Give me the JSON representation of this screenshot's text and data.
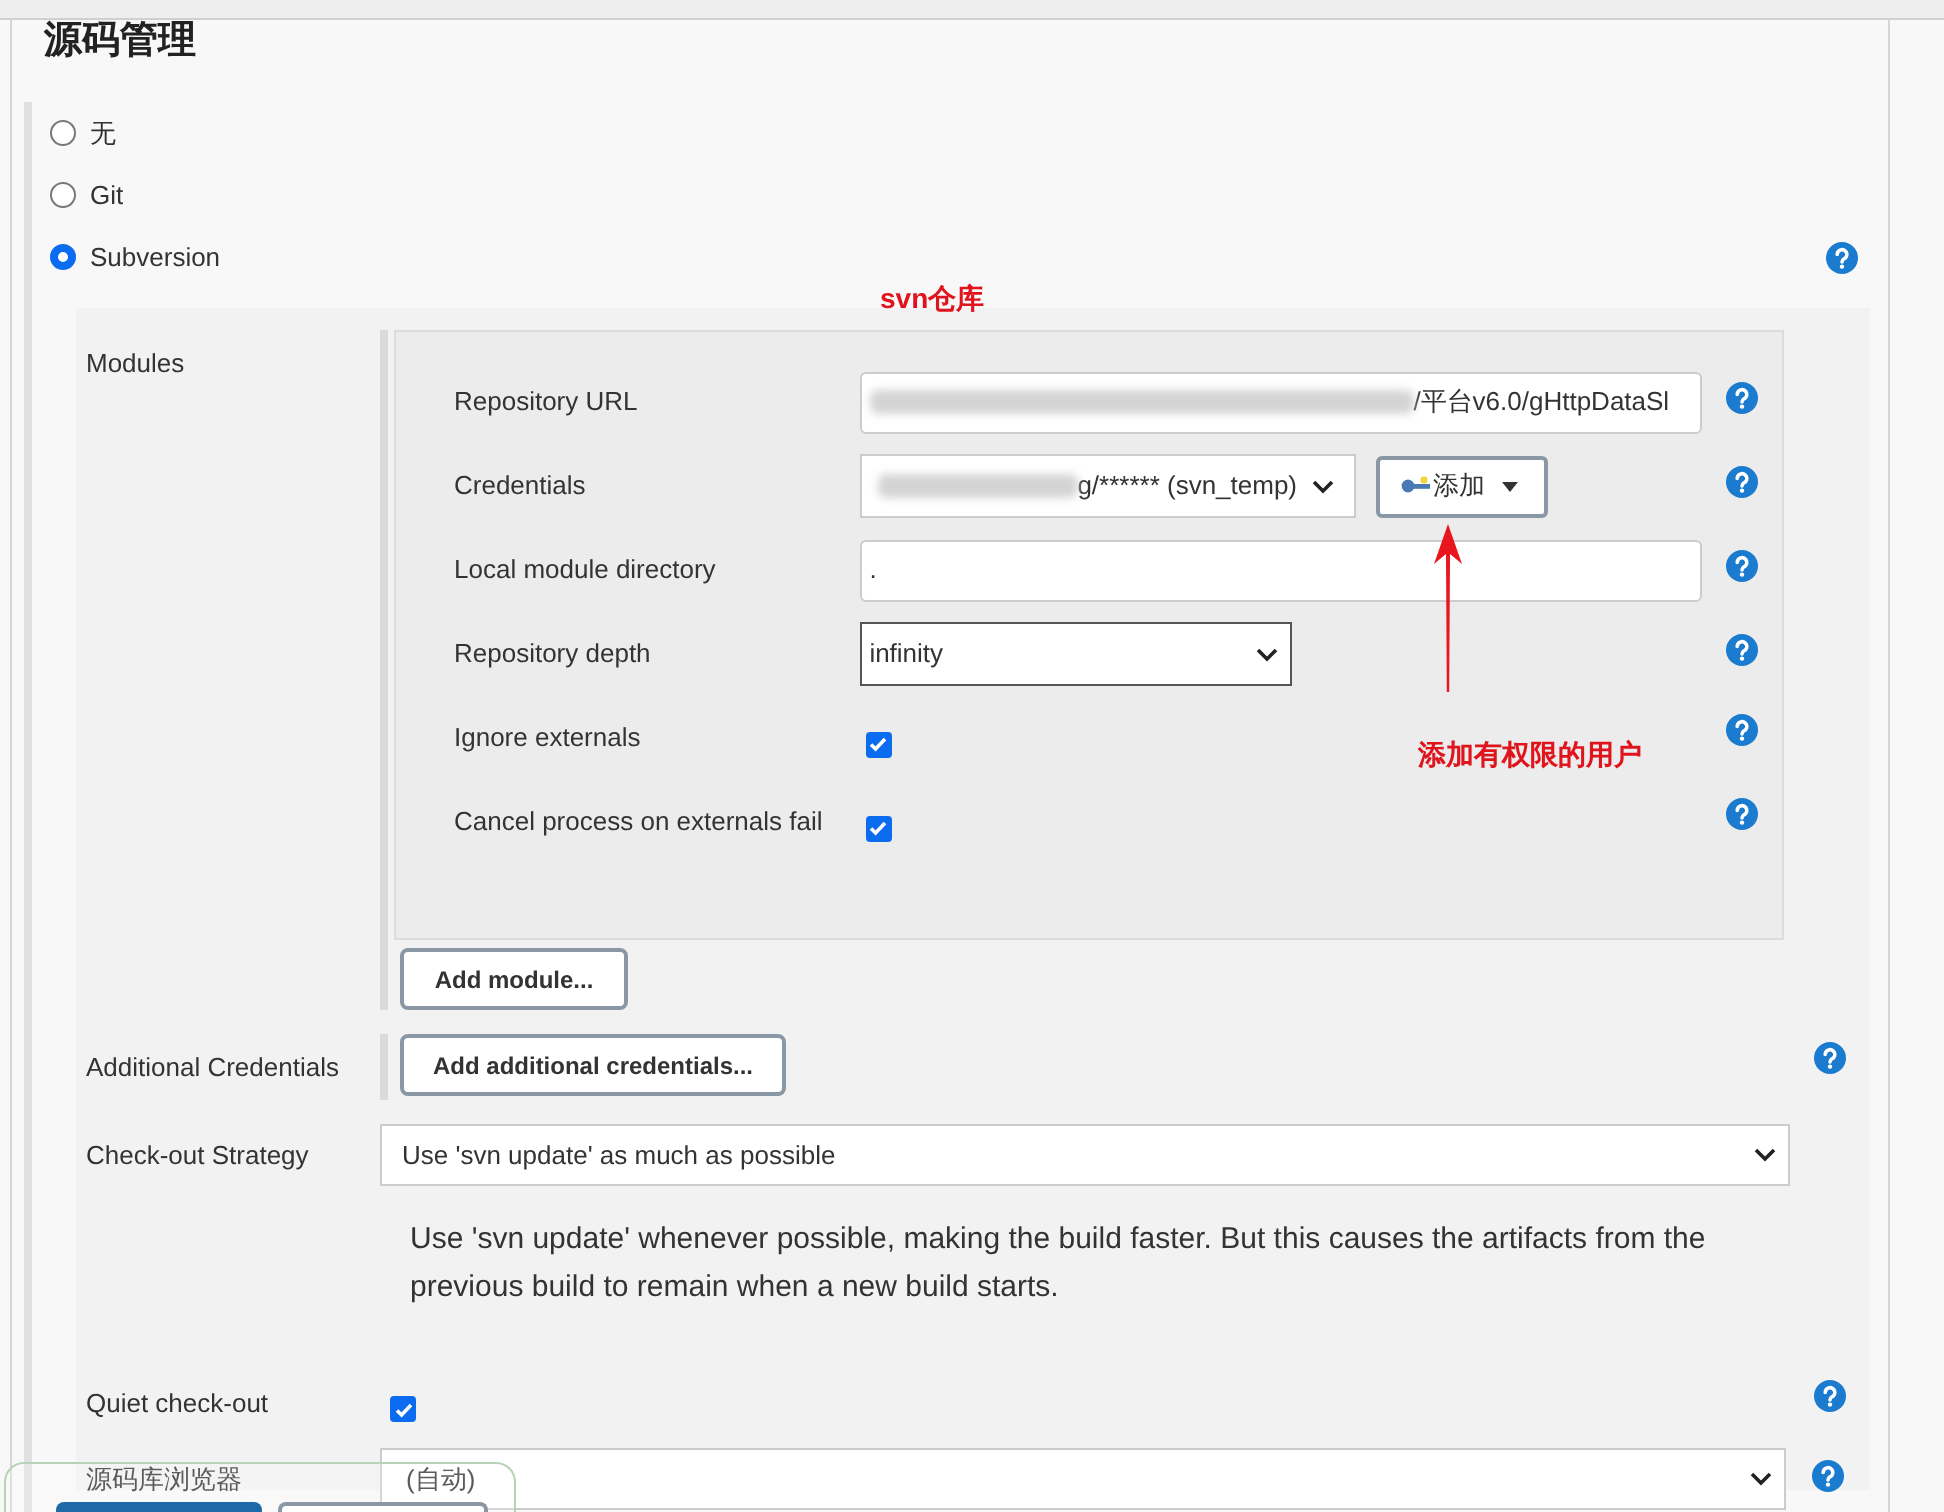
{
  "heading": "源码管理",
  "scm_options": [
    {
      "label": "无",
      "selected": false
    },
    {
      "label": "Git",
      "selected": false
    },
    {
      "label": "Subversion",
      "selected": true
    }
  ],
  "modules": {
    "label": "Modules",
    "fields": [
      {
        "kind": "text",
        "label": "Repository URL",
        "value": "/平台v6.0/gHttpDataSl",
        "redacted": true
      },
      {
        "kind": "credentials",
        "label": "Credentials",
        "value": "g/****** (svn_temp)",
        "redacted": true,
        "add_button": "添加"
      },
      {
        "kind": "text",
        "label": "Local module directory",
        "value": ".",
        "redacted": false
      },
      {
        "kind": "select",
        "label": "Repository depth",
        "value": "infinity"
      },
      {
        "kind": "checkbox",
        "label": "Ignore externals",
        "checked": true
      },
      {
        "kind": "checkbox",
        "label": "Cancel process on externals fail",
        "checked": true
      }
    ],
    "add_button": "Add module..."
  },
  "additional_credentials": {
    "label": "Additional Credentials",
    "button": "Add additional credentials..."
  },
  "checkout_strategy": {
    "label": "Check-out Strategy",
    "value": "Use 'svn update' as much as possible",
    "description": "Use 'svn update' whenever possible, making the build faster. But this causes the artifacts from the previous build to remain when a new build starts."
  },
  "quiet_checkout": {
    "label": "Quiet check-out",
    "checked": true
  },
  "repository_browser": {
    "label": "源码库浏览器",
    "value": "(自动)"
  },
  "annotations": [
    {
      "text": "svn仓库"
    },
    {
      "text": "添加有权限的用户"
    }
  ]
}
